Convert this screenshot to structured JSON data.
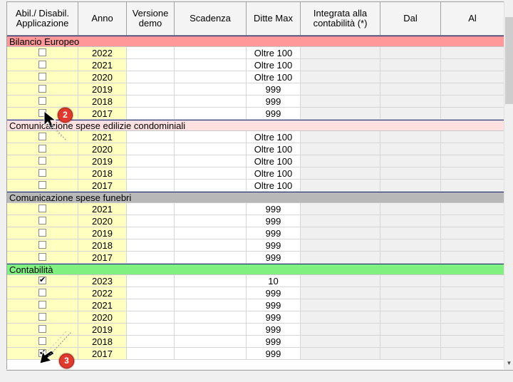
{
  "columns": [
    {
      "key": "abil",
      "label": "Abil./ Disabil.\nApplicazione"
    },
    {
      "key": "anno",
      "label": "Anno"
    },
    {
      "key": "demo",
      "label": "Versione\ndemo"
    },
    {
      "key": "scadenza",
      "label": "Scadenza"
    },
    {
      "key": "ditte",
      "label": "Ditte Max"
    },
    {
      "key": "integrata",
      "label": "Integrata alla\ncontabilità (*)"
    },
    {
      "key": "dal",
      "label": "Dal"
    },
    {
      "key": "al",
      "label": "Al"
    }
  ],
  "groups": [
    {
      "name": "Bilancio Europeo",
      "color": "#ff9898",
      "rows": [
        {
          "checked": false,
          "year": "2022",
          "max": "Oltre 100"
        },
        {
          "checked": false,
          "year": "2021",
          "max": "Oltre 100"
        },
        {
          "checked": false,
          "year": "2020",
          "max": "Oltre 100"
        },
        {
          "checked": false,
          "year": "2019",
          "max": "999"
        },
        {
          "checked": false,
          "year": "2018",
          "max": "999"
        },
        {
          "checked": false,
          "year": "2017",
          "max": "999"
        }
      ]
    },
    {
      "name": "Comunicazione spese edilizie condominiali",
      "color": "#ffe0e0",
      "rows": [
        {
          "checked": false,
          "year": "2021",
          "max": "Oltre 100"
        },
        {
          "checked": false,
          "year": "2020",
          "max": "Oltre 100"
        },
        {
          "checked": false,
          "year": "2019",
          "max": "Oltre 100"
        },
        {
          "checked": false,
          "year": "2018",
          "max": "Oltre 100"
        },
        {
          "checked": false,
          "year": "2017",
          "max": "Oltre 100"
        }
      ]
    },
    {
      "name": "Comunicazione spese funebri",
      "color": "#b8b8b8",
      "rows": [
        {
          "checked": false,
          "year": "2021",
          "max": "999"
        },
        {
          "checked": false,
          "year": "2020",
          "max": "999"
        },
        {
          "checked": false,
          "year": "2019",
          "max": "999"
        },
        {
          "checked": false,
          "year": "2018",
          "max": "999"
        },
        {
          "checked": false,
          "year": "2017",
          "max": "999"
        }
      ]
    },
    {
      "name": "Contabilità",
      "color": "#80f080",
      "rows": [
        {
          "checked": true,
          "year": "2023",
          "max": "10"
        },
        {
          "checked": false,
          "year": "2022",
          "max": "999"
        },
        {
          "checked": false,
          "year": "2021",
          "max": "999"
        },
        {
          "checked": false,
          "year": "2020",
          "max": "999"
        },
        {
          "checked": false,
          "year": "2019",
          "max": "999"
        },
        {
          "checked": false,
          "year": "2018",
          "max": "999"
        },
        {
          "checked": true,
          "year": "2017",
          "max": "999"
        }
      ]
    }
  ],
  "annotations": [
    {
      "label": "2"
    },
    {
      "label": "3"
    }
  ],
  "icons": {
    "check": "✔",
    "scroll_down": "▼"
  }
}
